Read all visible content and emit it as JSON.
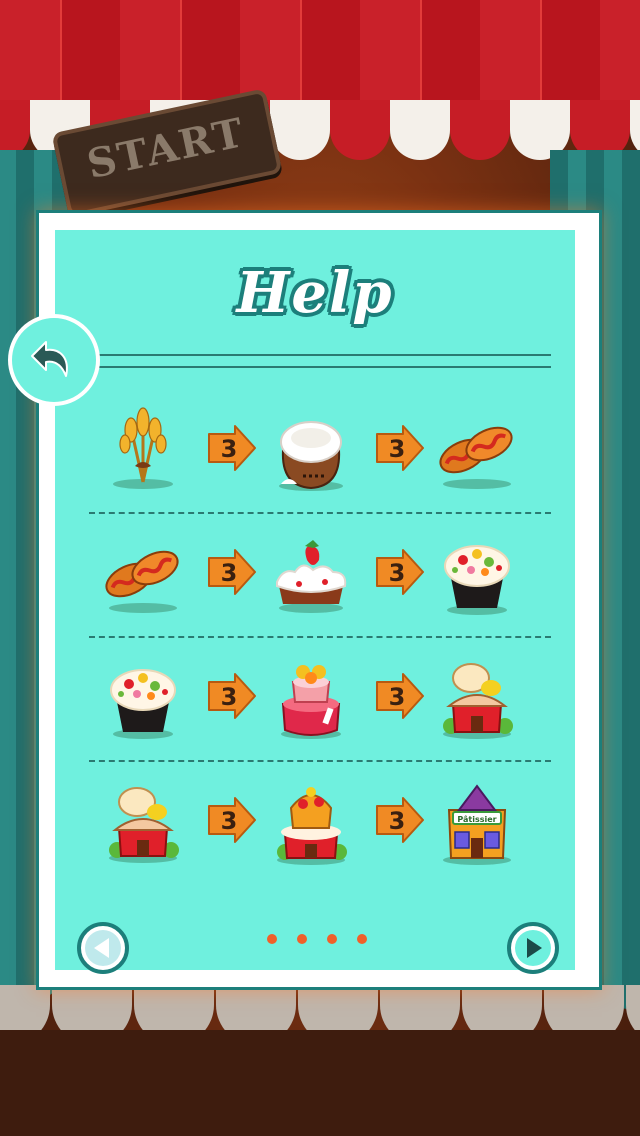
{
  "stage": {
    "start_sign": "START"
  },
  "help": {
    "title": "Help",
    "recipes": [
      {
        "from": "wheat-icon",
        "count1": "3",
        "middle": "flour-sack-icon",
        "count2": "3",
        "to": "bread-icon"
      },
      {
        "from": "bread-icon",
        "count1": "3",
        "middle": "strawberry-cake-icon",
        "count2": "3",
        "to": "fruit-cupcake-icon"
      },
      {
        "from": "fruit-cupcake-icon",
        "count1": "3",
        "middle": "layer-cake-icon",
        "count2": "3",
        "to": "bakery-hut-icon"
      },
      {
        "from": "bakery-hut-icon",
        "count1": "3",
        "middle": "cake-house-icon",
        "count2": "3",
        "to": "patisserie-icon"
      }
    ],
    "patisserie_sign": "Pâtissier",
    "pagination": {
      "pages": 4,
      "current": 1
    }
  },
  "colors": {
    "panel_bg": "#6ff0de",
    "panel_border": "#1c7f7b",
    "arrow": "#f08a24",
    "dot": "#f0602a"
  }
}
